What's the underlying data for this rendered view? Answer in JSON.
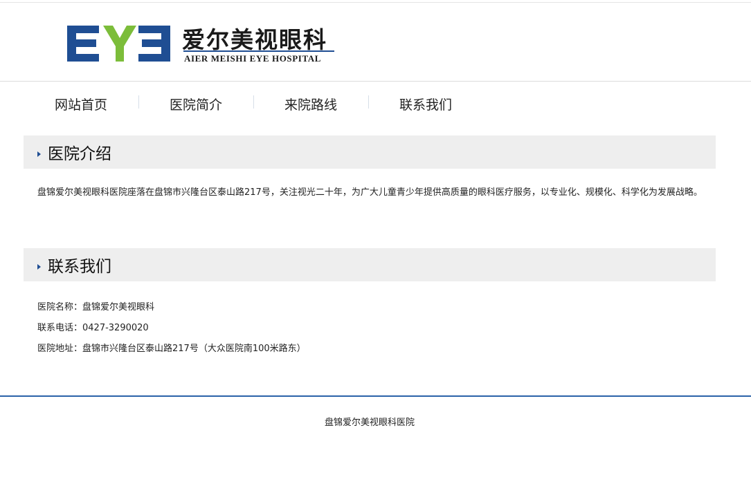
{
  "header": {
    "logo_mark": "EYE",
    "logo_cn": "爱尔美视眼科",
    "logo_en": "AIER MEISHI EYE HOSPITAL",
    "colors": {
      "brand_blue": "#1f4e93",
      "brand_green": "#7cbd3a"
    }
  },
  "nav": {
    "items": [
      {
        "label": "网站首页"
      },
      {
        "label": "医院简介"
      },
      {
        "label": "来院路线"
      },
      {
        "label": "联系我们"
      }
    ]
  },
  "intro": {
    "title": "医院介绍",
    "body": "盘锦爱尔美视眼科医院座落在盘锦市兴隆台区泰山路217号，关注视光二十年，为广大儿童青少年提供高质量的眼科医疗服务，以专业化、规模化、科学化为发展战略。"
  },
  "contact": {
    "title": "联系我们",
    "name_line": "医院名称：盘锦爱尔美视眼科",
    "phone_line": "联系电话：0427-3290020",
    "address_line": "医院地址：盘锦市兴隆台区泰山路217号（大众医院南100米路东）"
  },
  "footer": {
    "text": "盘锦爱尔美视眼科医院",
    "rule_color": "#2a62a8"
  }
}
